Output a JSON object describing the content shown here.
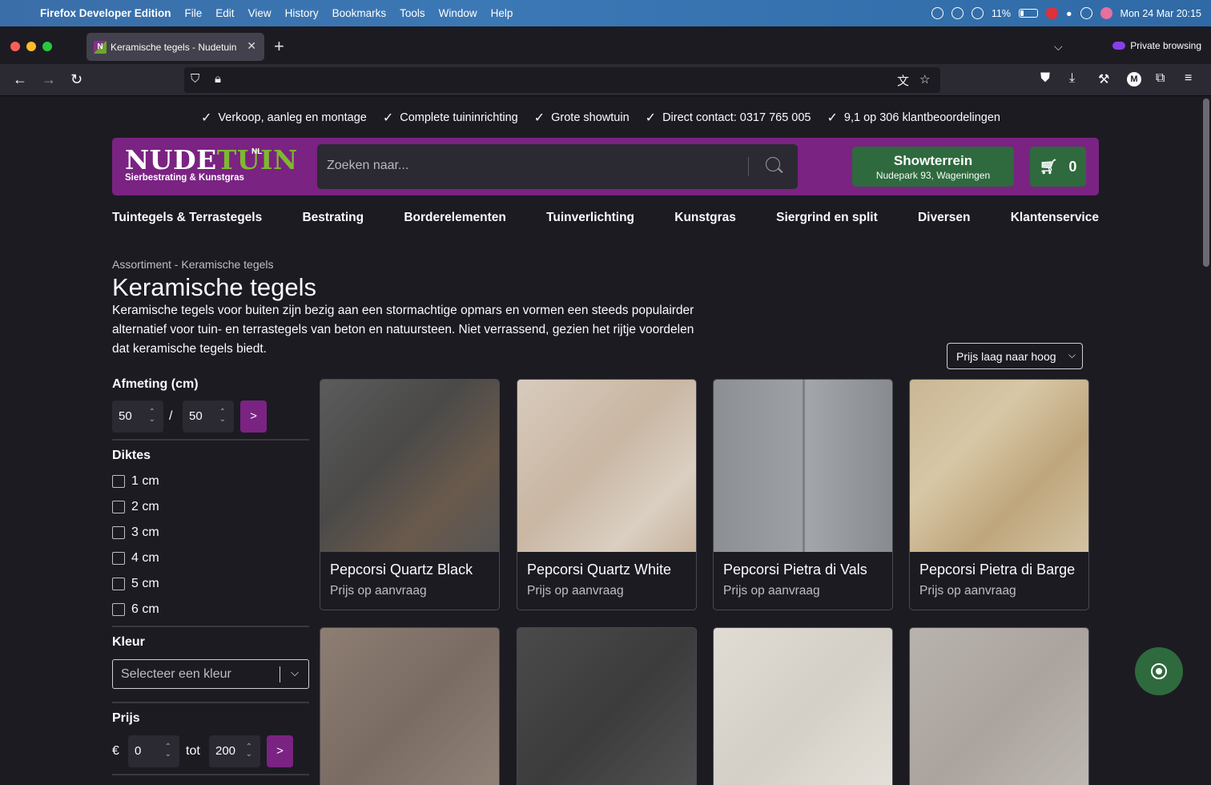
{
  "menubar": {
    "app": "Firefox Developer Edition",
    "items": [
      "File",
      "Edit",
      "View",
      "History",
      "Bookmarks",
      "Tools",
      "Window",
      "Help"
    ],
    "battery": "11%",
    "datetime": "Mon 24 Mar  20:15"
  },
  "browser": {
    "tab_title": "Keramische tegels - Nudetuin",
    "private_label": "Private browsing",
    "profile_initial": "M"
  },
  "site": {
    "usps": [
      "Verkoop, aanleg en montage",
      "Complete tuininrichting",
      "Grote showtuin",
      "Direct contact: 0317 765 005",
      "9,1 op 306 klantbeoordelingen"
    ],
    "logo": {
      "word1": "NUDE",
      "word2": "TUIN",
      "suffix": "NL",
      "tagline": "Sierbestrating & Kunstgras"
    },
    "search_placeholder": "Zoeken naar...",
    "showroom": {
      "title": "Showterrein",
      "address": "Nudepark 93, Wageningen"
    },
    "cart_count": "0",
    "nav": [
      "Tuintegels & Terrastegels",
      "Bestrating",
      "Borderelementen",
      "Tuinverlichting",
      "Kunstgras",
      "Siergrind en split",
      "Diversen",
      "Klantenservice"
    ]
  },
  "category": {
    "breadcrumb": "Assortiment - Keramische tegels",
    "title": "Keramische tegels",
    "intro": "Keramische tegels voor buiten zijn bezig aan een stormachtige opmars en vormen een steeds populairder alternatief voor tuin- en terrastegels van beton en natuursteen. Niet verrassend, gezien het rijtje voordelen dat keramische tegels biedt.",
    "sort": "Prijs laag naar hoog"
  },
  "filters": {
    "size_label": "Afmeting (cm)",
    "size_w": "50",
    "size_sep": "/",
    "size_h": "50",
    "go": ">",
    "thickness_label": "Diktes",
    "thicknesses": [
      "1 cm",
      "2 cm",
      "3 cm",
      "4 cm",
      "5 cm",
      "6 cm"
    ],
    "color_label": "Kleur",
    "color_placeholder": "Selecteer een kleur",
    "price_label": "Prijs",
    "currency": "€",
    "price_min": "0",
    "price_to": "tot",
    "price_max": "200"
  },
  "products": [
    {
      "name": "Pepcorsi Quartz Black",
      "price": "Prijs op aanvraag"
    },
    {
      "name": "Pepcorsi Quartz White",
      "price": "Prijs op aanvraag"
    },
    {
      "name": "Pepcorsi Pietra di Vals",
      "price": "Prijs op aanvraag"
    },
    {
      "name": "Pepcorsi Pietra di Barge",
      "price": "Prijs op aanvraag"
    }
  ]
}
